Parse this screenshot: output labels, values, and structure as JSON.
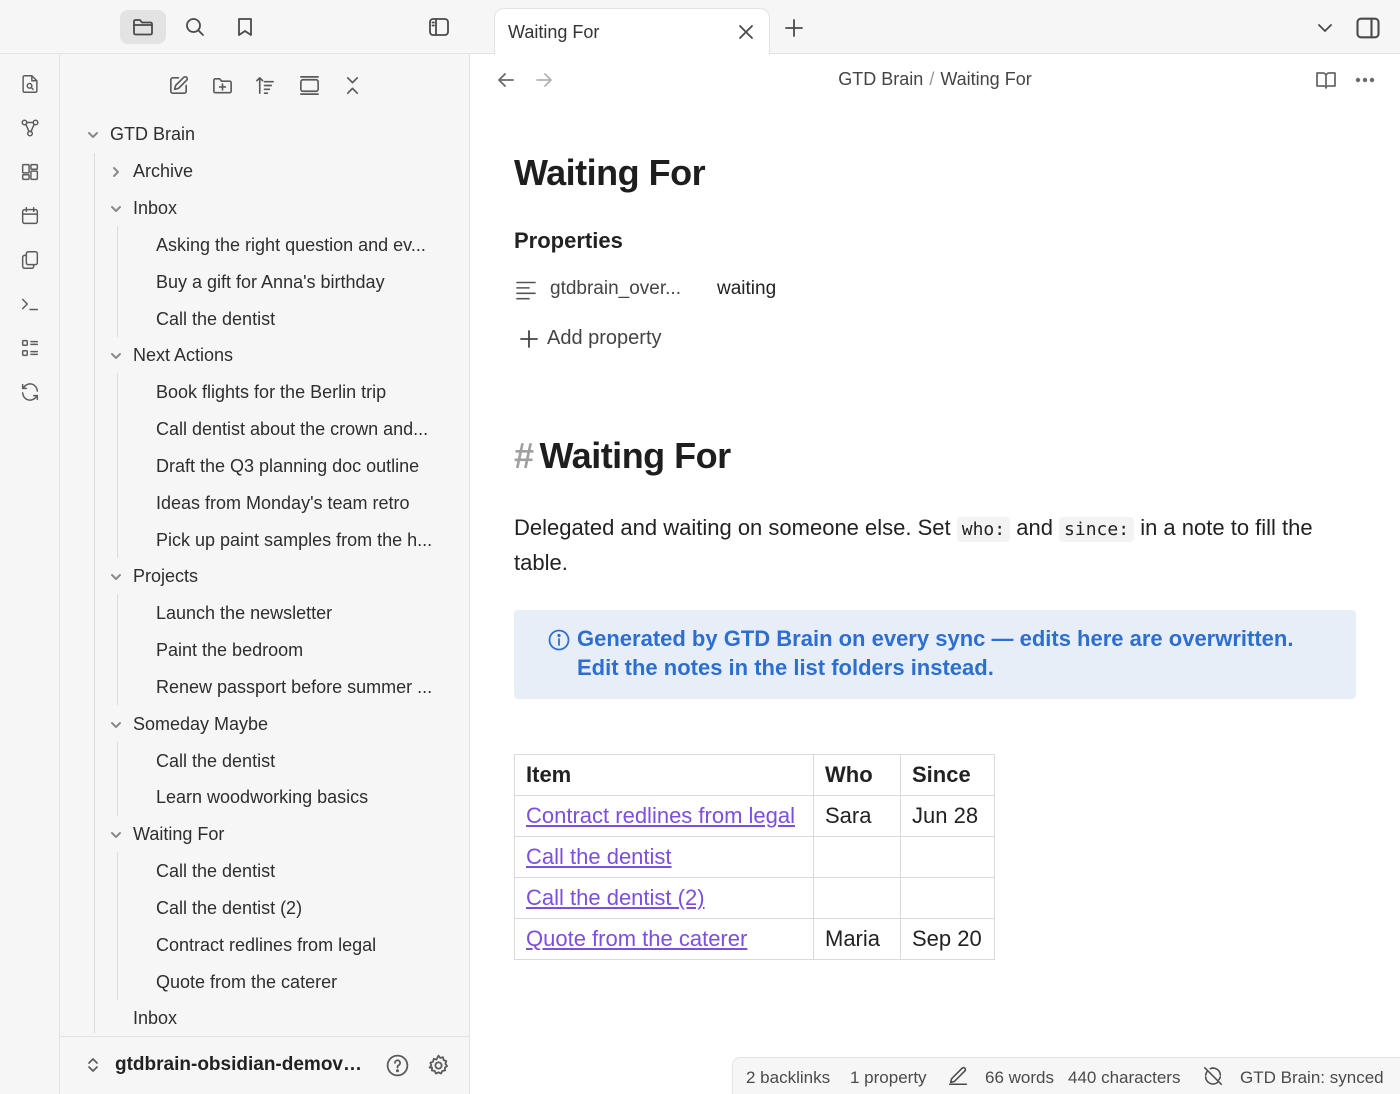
{
  "app": {
    "tab_title": "Waiting For",
    "breadcrumb": [
      "GTD Brain",
      "Waiting For"
    ],
    "breadcrumb_separator": "/"
  },
  "ribbon": {
    "icons": [
      "search-file-icon",
      "graph-icon",
      "canvas-icon",
      "calendar-icon",
      "copy-icon",
      "terminal-icon",
      "list-icon",
      "sync-icon"
    ]
  },
  "sidebar": {
    "top_icons": [
      "folder-icon",
      "search-icon",
      "bookmark-icon",
      "sidebar-toggle-icon"
    ],
    "action_icons": [
      "new-note-icon",
      "new-folder-icon",
      "sort-icon",
      "collapse-view-icon",
      "collapse-all-icon"
    ],
    "tree": {
      "root": "GTD Brain",
      "archive": "Archive",
      "inbox": "Inbox",
      "inbox_items": [
        "Asking the right question and ev...",
        "Buy a gift for Anna's birthday",
        "Call the dentist"
      ],
      "next_actions": "Next Actions",
      "next_actions_items": [
        "Book flights for the Berlin trip",
        "Call dentist about the crown and...",
        "Draft the Q3 planning doc outline",
        "Ideas from Monday's team retro",
        "Pick up paint samples from the h..."
      ],
      "projects": "Projects",
      "projects_items": [
        "Launch the newsletter",
        "Paint the bedroom",
        "Renew passport before summer ..."
      ],
      "someday": "Someday Maybe",
      "someday_items": [
        "Call the dentist",
        "Learn woodworking basics"
      ],
      "waiting": "Waiting For",
      "waiting_items": [
        "Call the dentist",
        "Call the dentist (2)",
        "Contract redlines from legal",
        "Quote from the caterer"
      ],
      "inbox_file": "Inbox"
    },
    "vault_name": "gtdbrain-obsidian-demova..."
  },
  "note": {
    "title": "Waiting For",
    "properties_heading": "Properties",
    "property_key": "gtdbrain_over...",
    "property_value": "waiting",
    "add_property": "Add property",
    "heading_hash": "#",
    "heading": "Waiting For",
    "para_1": "Delegated and waiting on someone else. Set ",
    "code_1": "who:",
    "para_2": " and ",
    "code_2": "since:",
    "para_3": " in a note to fill the table.",
    "callout": "Generated by GTD Brain on every sync — edits here are overwritten. Edit the notes in the list folders instead.",
    "table": {
      "headers": [
        "Item",
        "Who",
        "Since"
      ],
      "rows": [
        [
          "Contract redlines from legal",
          "Sara",
          "Jun 28"
        ],
        [
          "Call the dentist",
          "",
          ""
        ],
        [
          "Call the dentist (2)",
          "",
          ""
        ],
        [
          "Quote from the caterer",
          "Maria",
          "Sep 20"
        ]
      ]
    }
  },
  "status_bar": {
    "backlinks": "2 backlinks",
    "properties": "1 property",
    "words": "66 words",
    "characters": "440 characters",
    "sync": "GTD Brain: synced"
  },
  "colors": {
    "accent_link": "#7b4fe0",
    "callout_text": "#2c6fd1",
    "callout_bg": "#e8eef8",
    "sidebar_bg": "#f6f6f6"
  }
}
